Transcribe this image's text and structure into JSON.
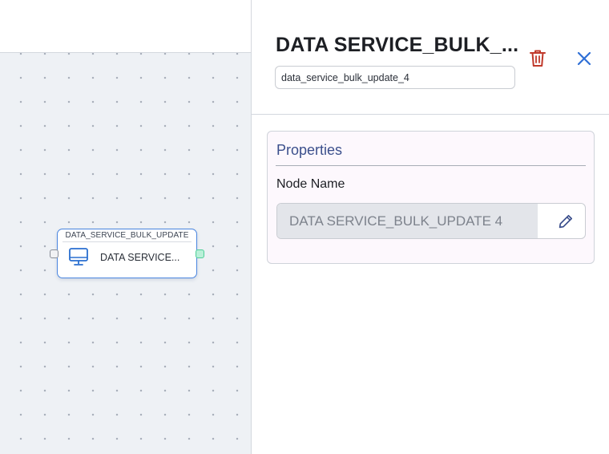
{
  "canvas": {
    "node": {
      "type_title": "DATA_SERVICE_BULK_UPDATE",
      "label": "DATA SERVICE...",
      "icon": "monitor-icon"
    }
  },
  "panel": {
    "title": "DATA SERVICE_BULK_...",
    "node_id": "data_service_bulk_update_4",
    "delete_icon": "trash-icon",
    "close_icon": "close-icon",
    "properties": {
      "heading": "Properties",
      "node_name_label": "Node Name",
      "node_name_value": "DATA SERVICE_BULK_UPDATE 4",
      "edit_icon": "pencil-icon"
    }
  },
  "colors": {
    "node_border": "#4a86e0",
    "output_port": "#4fcf98",
    "delete_icon": "#c0392b",
    "close_icon": "#2f6fd6",
    "properties_heading": "#3b4f8c"
  }
}
